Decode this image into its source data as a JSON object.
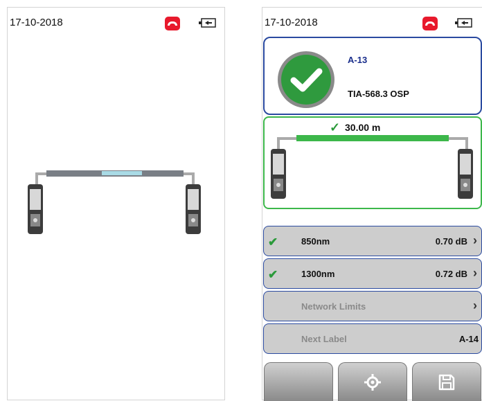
{
  "left_screen": {
    "date": "17-10-2018"
  },
  "right_screen": {
    "date": "17-10-2018",
    "result": {
      "label": "A-13",
      "test_limit": "TIA-568.3 OSP",
      "status_icon": "pass-check-icon"
    },
    "length": "30.00 m",
    "measurements": [
      {
        "name": "850nm",
        "value": "0.70 dB",
        "status": "pass"
      },
      {
        "name": "1300nm",
        "value": "0.72 dB",
        "status": "pass"
      }
    ],
    "network_limits_label": "Network Limits",
    "next_label": {
      "name": "Next Label",
      "value": "A-14"
    },
    "buttons": [
      "blank",
      "locate-icon",
      "save-icon"
    ]
  },
  "colors": {
    "phone_red": "#e8192c",
    "pass_green": "#3cb74a",
    "border_blue": "#2a4aa0"
  }
}
